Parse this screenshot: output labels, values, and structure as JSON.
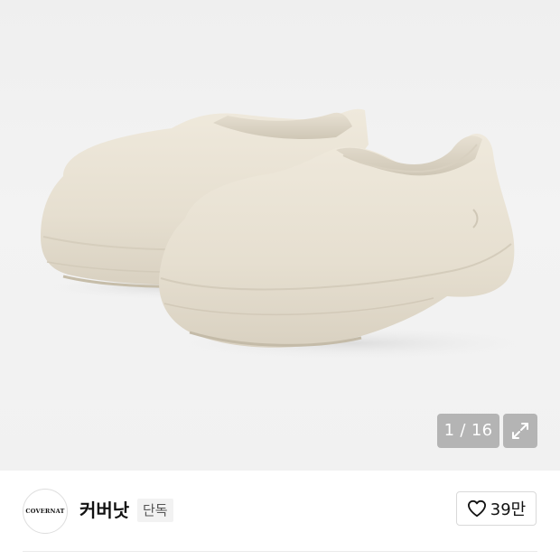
{
  "gallery": {
    "image_alt": "Covernat clog product image",
    "counter_text": "1 / 16",
    "expand_icon": "expand-arrows-icon"
  },
  "brand": {
    "logo_text": "COVERNAT",
    "name": "커버낫",
    "badge": "단독"
  },
  "like": {
    "icon": "heart-outline-icon",
    "count": "39만"
  }
}
